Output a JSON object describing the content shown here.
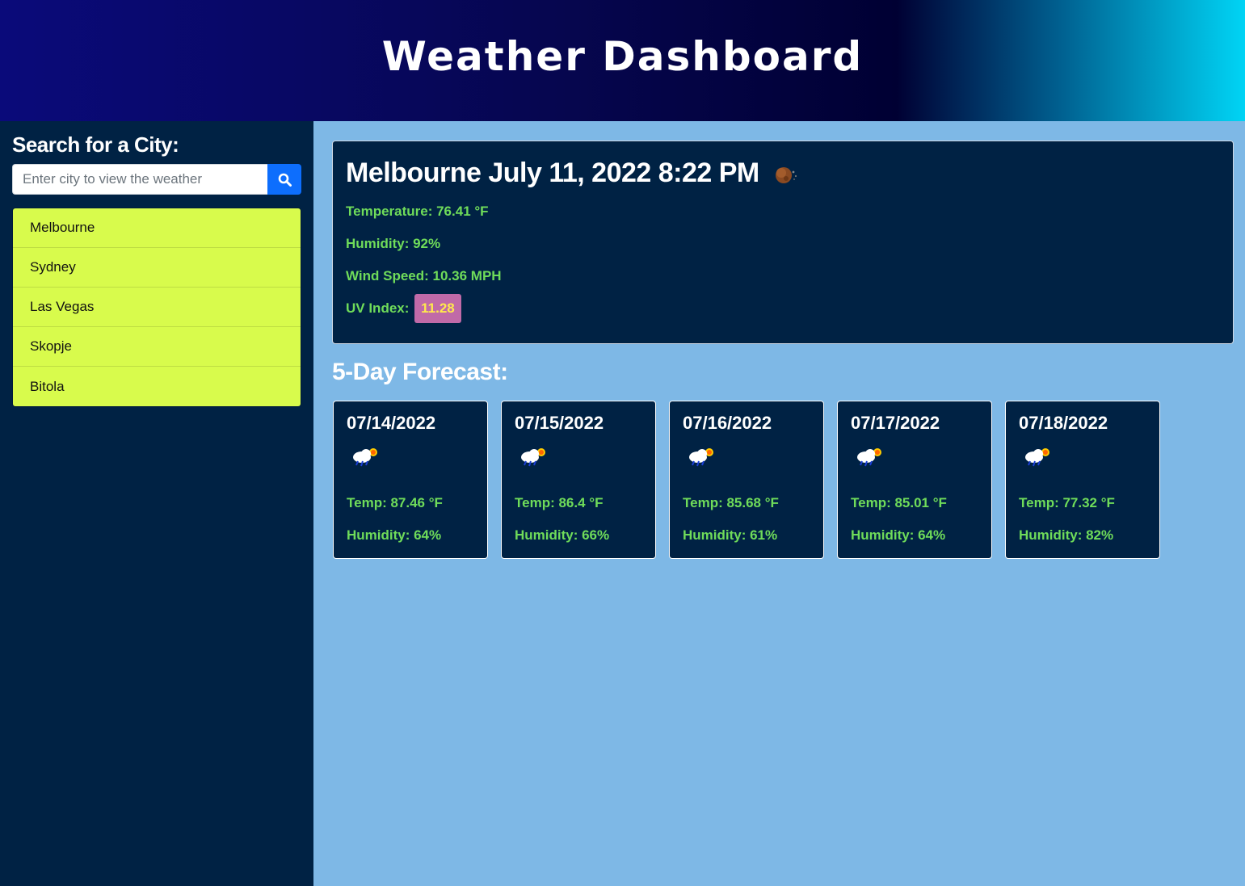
{
  "header": {
    "title": "Weather Dashboard"
  },
  "sidebar": {
    "search_title": "Search for a City:",
    "search_placeholder": "Enter city to view the weather",
    "cities": [
      "Melbourne",
      "Sydney",
      "Las Vegas",
      "Skopje",
      "Bitola"
    ]
  },
  "current": {
    "title": "Melbourne July 11, 2022 8:22 PM",
    "icon": "night-moon-icon",
    "temperature": "Temperature: 76.41 °F",
    "humidity": "Humidity: 92%",
    "wind": "Wind Speed: 10.36 MPH",
    "uv_label": "UV Index:",
    "uv_value": "11.28"
  },
  "forecast": {
    "title": "5-Day Forecast:",
    "days": [
      {
        "date": "07/14/2022",
        "icon": "rain-sun-cloud-icon",
        "temp": "Temp: 87.46 °F",
        "humidity": "Humidity: 64%"
      },
      {
        "date": "07/15/2022",
        "icon": "rain-sun-cloud-icon",
        "temp": "Temp: 86.4 °F",
        "humidity": "Humidity: 66%"
      },
      {
        "date": "07/16/2022",
        "icon": "rain-sun-cloud-icon",
        "temp": "Temp: 85.68 °F",
        "humidity": "Humidity: 61%"
      },
      {
        "date": "07/17/2022",
        "icon": "rain-sun-cloud-icon",
        "temp": "Temp: 85.01 °F",
        "humidity": "Humidity: 64%"
      },
      {
        "date": "07/18/2022",
        "icon": "rain-sun-cloud-icon",
        "temp": "Temp: 77.32 °F",
        "humidity": "Humidity: 82%"
      }
    ]
  },
  "colors": {
    "sidebar_bg": "#002244",
    "main_bg": "#7eb8e6",
    "city_button": "#d8fb4c",
    "stat_text": "#6fdc5a",
    "uv_badge": "#c06aa8",
    "search_button": "#0d6efd"
  }
}
